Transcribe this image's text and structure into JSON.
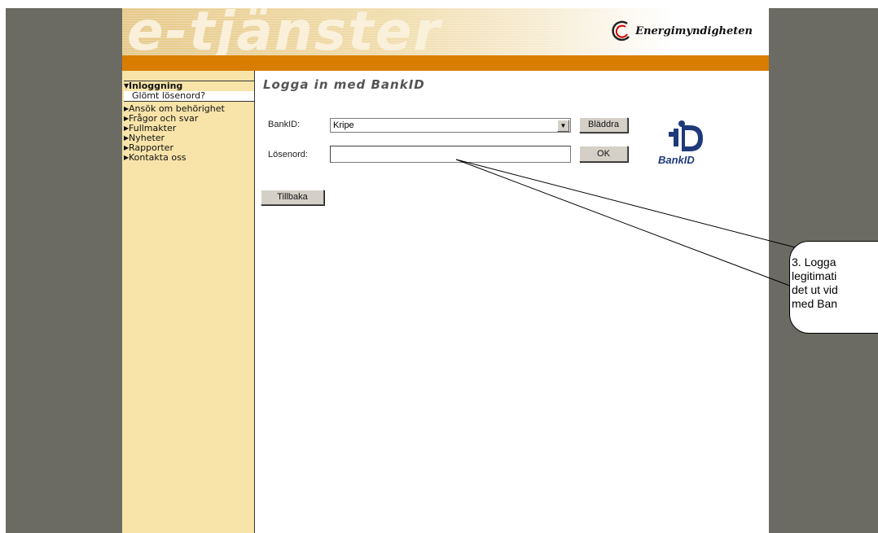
{
  "header": {
    "brand": "e-tjänster",
    "logo_text": "Energimyndigheten"
  },
  "nav": {
    "active": "Inloggning",
    "sub_item": "Glömt lösenord?",
    "items": [
      "Ansök om behörighet",
      "Frågor och svar",
      "Fullmakter",
      "Nyheter",
      "Rapporter",
      "Kontakta oss"
    ]
  },
  "main": {
    "title": "Logga in med BankID",
    "bankid_label": "BankID:",
    "bankid_value": "Kripe",
    "browse_label": "Bläddra",
    "password_label": "Lösenord:",
    "password_value": "",
    "ok_label": "OK",
    "back_label": "Tillbaka",
    "bankid_logo_text": "BankID"
  },
  "callout": {
    "lines": [
      "3. Logga",
      "legitimati",
      "det ut vid",
      "med Ban"
    ]
  },
  "colors": {
    "orange_bar": "#d87d00",
    "nav_bg": "#f8e4a9",
    "side_bg": "#6b6b63",
    "bankid_blue": "#1f3a7a"
  }
}
